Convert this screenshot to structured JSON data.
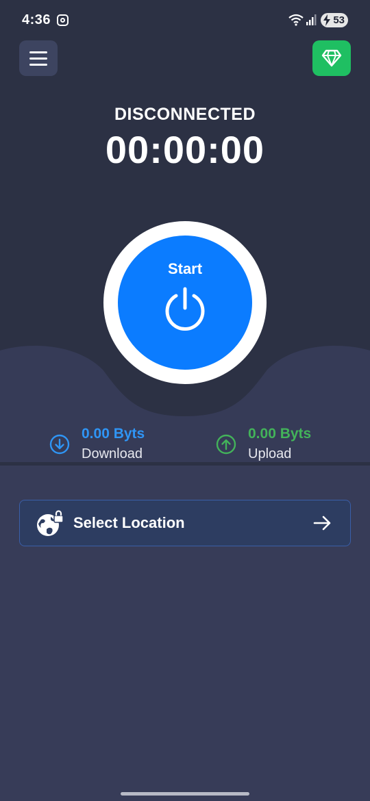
{
  "status_bar": {
    "time": "4:36",
    "battery_level": "53",
    "icons": [
      "instagram-icon",
      "wifi-icon",
      "signal-icon",
      "battery-charging-icon"
    ]
  },
  "header": {
    "menu_icon": "hamburger-menu-icon",
    "premium_icon": "diamond-icon",
    "premium_color": "#1fbf62"
  },
  "connection": {
    "status": "DISCONNECTED",
    "timer": "00:00:00"
  },
  "power": {
    "label": "Start",
    "icon": "power-icon",
    "color": "#0b7cff"
  },
  "stats": {
    "download": {
      "value": "0.00 Byts",
      "label": "Download",
      "icon": "arrow-down-circle-icon",
      "color": "#2f95f5"
    },
    "upload": {
      "value": "0.00 Byts",
      "label": "Upload",
      "icon": "arrow-up-circle-icon",
      "color": "#43b35a"
    }
  },
  "location": {
    "label": "Select Location",
    "icon": "globe-lock-icon",
    "action_icon": "arrow-right-icon"
  }
}
